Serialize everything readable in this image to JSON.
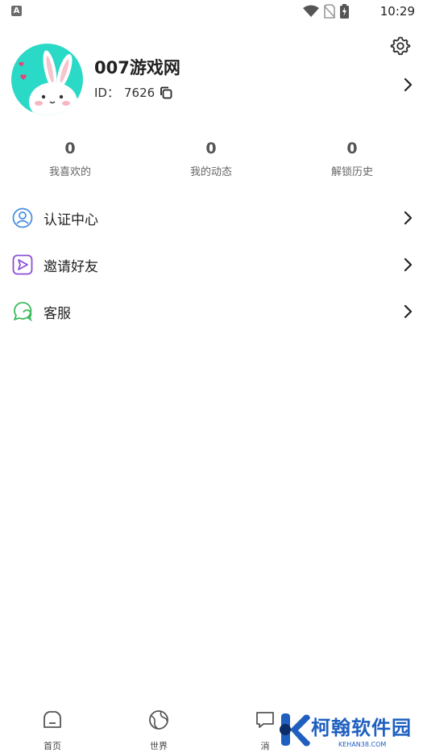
{
  "status_bar": {
    "time": "10:29",
    "notification_letter": "A"
  },
  "profile": {
    "name": "007游戏网",
    "id_label": "ID：",
    "id_value": "7626"
  },
  "stats": [
    {
      "value": "0",
      "label": "我喜欢的"
    },
    {
      "value": "0",
      "label": "我的动态"
    },
    {
      "value": "0",
      "label": "解锁历史"
    }
  ],
  "menu": [
    {
      "label": "认证中心",
      "icon": "user-circle-icon",
      "color": "#4a90e2"
    },
    {
      "label": "邀请好友",
      "icon": "send-icon",
      "color": "#8a4fd6"
    },
    {
      "label": "客服",
      "icon": "chat-bubble-icon",
      "color": "#3dbb5c"
    }
  ],
  "tabs": [
    {
      "label": "首页",
      "icon": "home-icon"
    },
    {
      "label": "世界",
      "icon": "globe-icon"
    },
    {
      "label": "消",
      "icon": "message-icon"
    }
  ],
  "watermark": {
    "text": "柯翰软件园",
    "sub": "KEHAN38.COM"
  },
  "colors": {
    "avatar_bg": "#2ad9c6",
    "watermark": "#1e5fbf"
  }
}
